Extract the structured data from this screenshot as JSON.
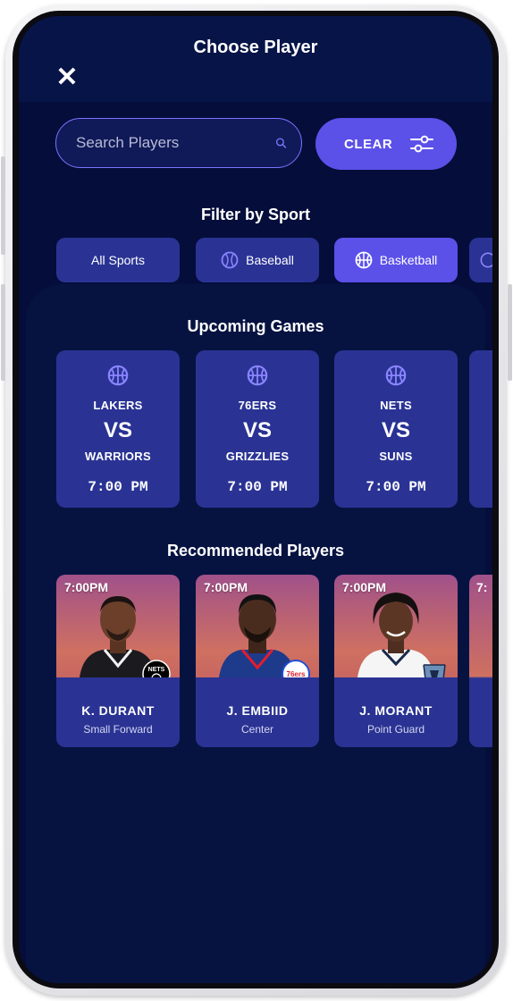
{
  "header": {
    "title": "Choose Player"
  },
  "search": {
    "placeholder": "Search Players",
    "clear_label": "CLEAR"
  },
  "filter": {
    "title": "Filter by Sport",
    "chips": [
      {
        "label": "All Sports",
        "icon": "none"
      },
      {
        "label": "Baseball",
        "icon": "baseball-icon"
      },
      {
        "label": "Basketball",
        "icon": "basketball-icon",
        "active": true
      }
    ]
  },
  "upcoming": {
    "title": "Upcoming Games",
    "games": [
      {
        "team1": "LAKERS",
        "vs": "VS",
        "team2": "WARRIORS",
        "time": "7:00 PM"
      },
      {
        "team1": "76ERS",
        "vs": "VS",
        "team2": "GRIZZLIES",
        "time": "7:00 PM"
      },
      {
        "team1": "NETS",
        "vs": "VS",
        "team2": "SUNS",
        "time": "7:00 PM"
      }
    ]
  },
  "recommended": {
    "title": "Recommended Players",
    "players": [
      {
        "time": "7:00PM",
        "name": "K. DURANT",
        "position": "Small Forward",
        "team_logo": "NETS"
      },
      {
        "time": "7:00PM",
        "name": "J. EMBIID",
        "position": "Center",
        "team_logo": "76ers"
      },
      {
        "time": "7:00PM",
        "name": "J. MORANT",
        "position": "Point Guard",
        "team_logo": "grizzlies-logo"
      }
    ],
    "peek_time": "7:"
  },
  "colors": {
    "background": "#050d3a",
    "card": "#2a3394",
    "accent": "#5b50e8",
    "search_border": "#7d73ff"
  }
}
